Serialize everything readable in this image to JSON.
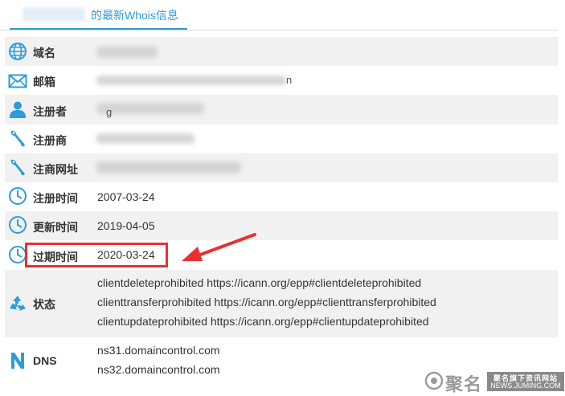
{
  "tab": {
    "title": "的最新Whois信息"
  },
  "rows": {
    "domain": {
      "label": "域名"
    },
    "email": {
      "label": "邮箱",
      "value_tail": "n"
    },
    "registrant": {
      "label": "注册者",
      "value_tail": "g"
    },
    "registrar": {
      "label": "注册商"
    },
    "registrar_url": {
      "label": "注商网址"
    },
    "created": {
      "label": "注册时间",
      "value": "2007-03-24"
    },
    "updated": {
      "label": "更新时间",
      "value": "2019-04-05"
    },
    "expires": {
      "label": "过期时间",
      "value": "2020-03-24"
    },
    "status": {
      "label": "状态",
      "values": [
        "clientdeleteprohibited https://icann.org/epp#clientdeleteprohibited",
        "clienttransferprohibited https://icann.org/epp#clienttransferprohibited",
        "clientupdateprohibited https://icann.org/epp#clientupdateprohibited"
      ]
    },
    "dns": {
      "label": "DNS",
      "values": [
        "ns31.domaincontrol.com",
        "ns32.domaincontrol.com"
      ]
    }
  },
  "watermark": {
    "name": "聚名",
    "line1": "聚名旗下资讯网站",
    "line2": "NEWS.JUMING.COM"
  },
  "colors": {
    "accent": "#2b9ddb",
    "highlight": "#e8312f",
    "row_grey": "#f1f1f1"
  },
  "icons": {
    "domain": "globe-icon",
    "email": "envelope-icon",
    "registrant": "person-icon",
    "registrar": "wrench-icon",
    "registrar_url": "wrench-icon",
    "created": "clock-icon",
    "updated": "clock-icon",
    "expires": "clock-icon",
    "status": "recycle-icon",
    "dns": "dns-icon"
  }
}
